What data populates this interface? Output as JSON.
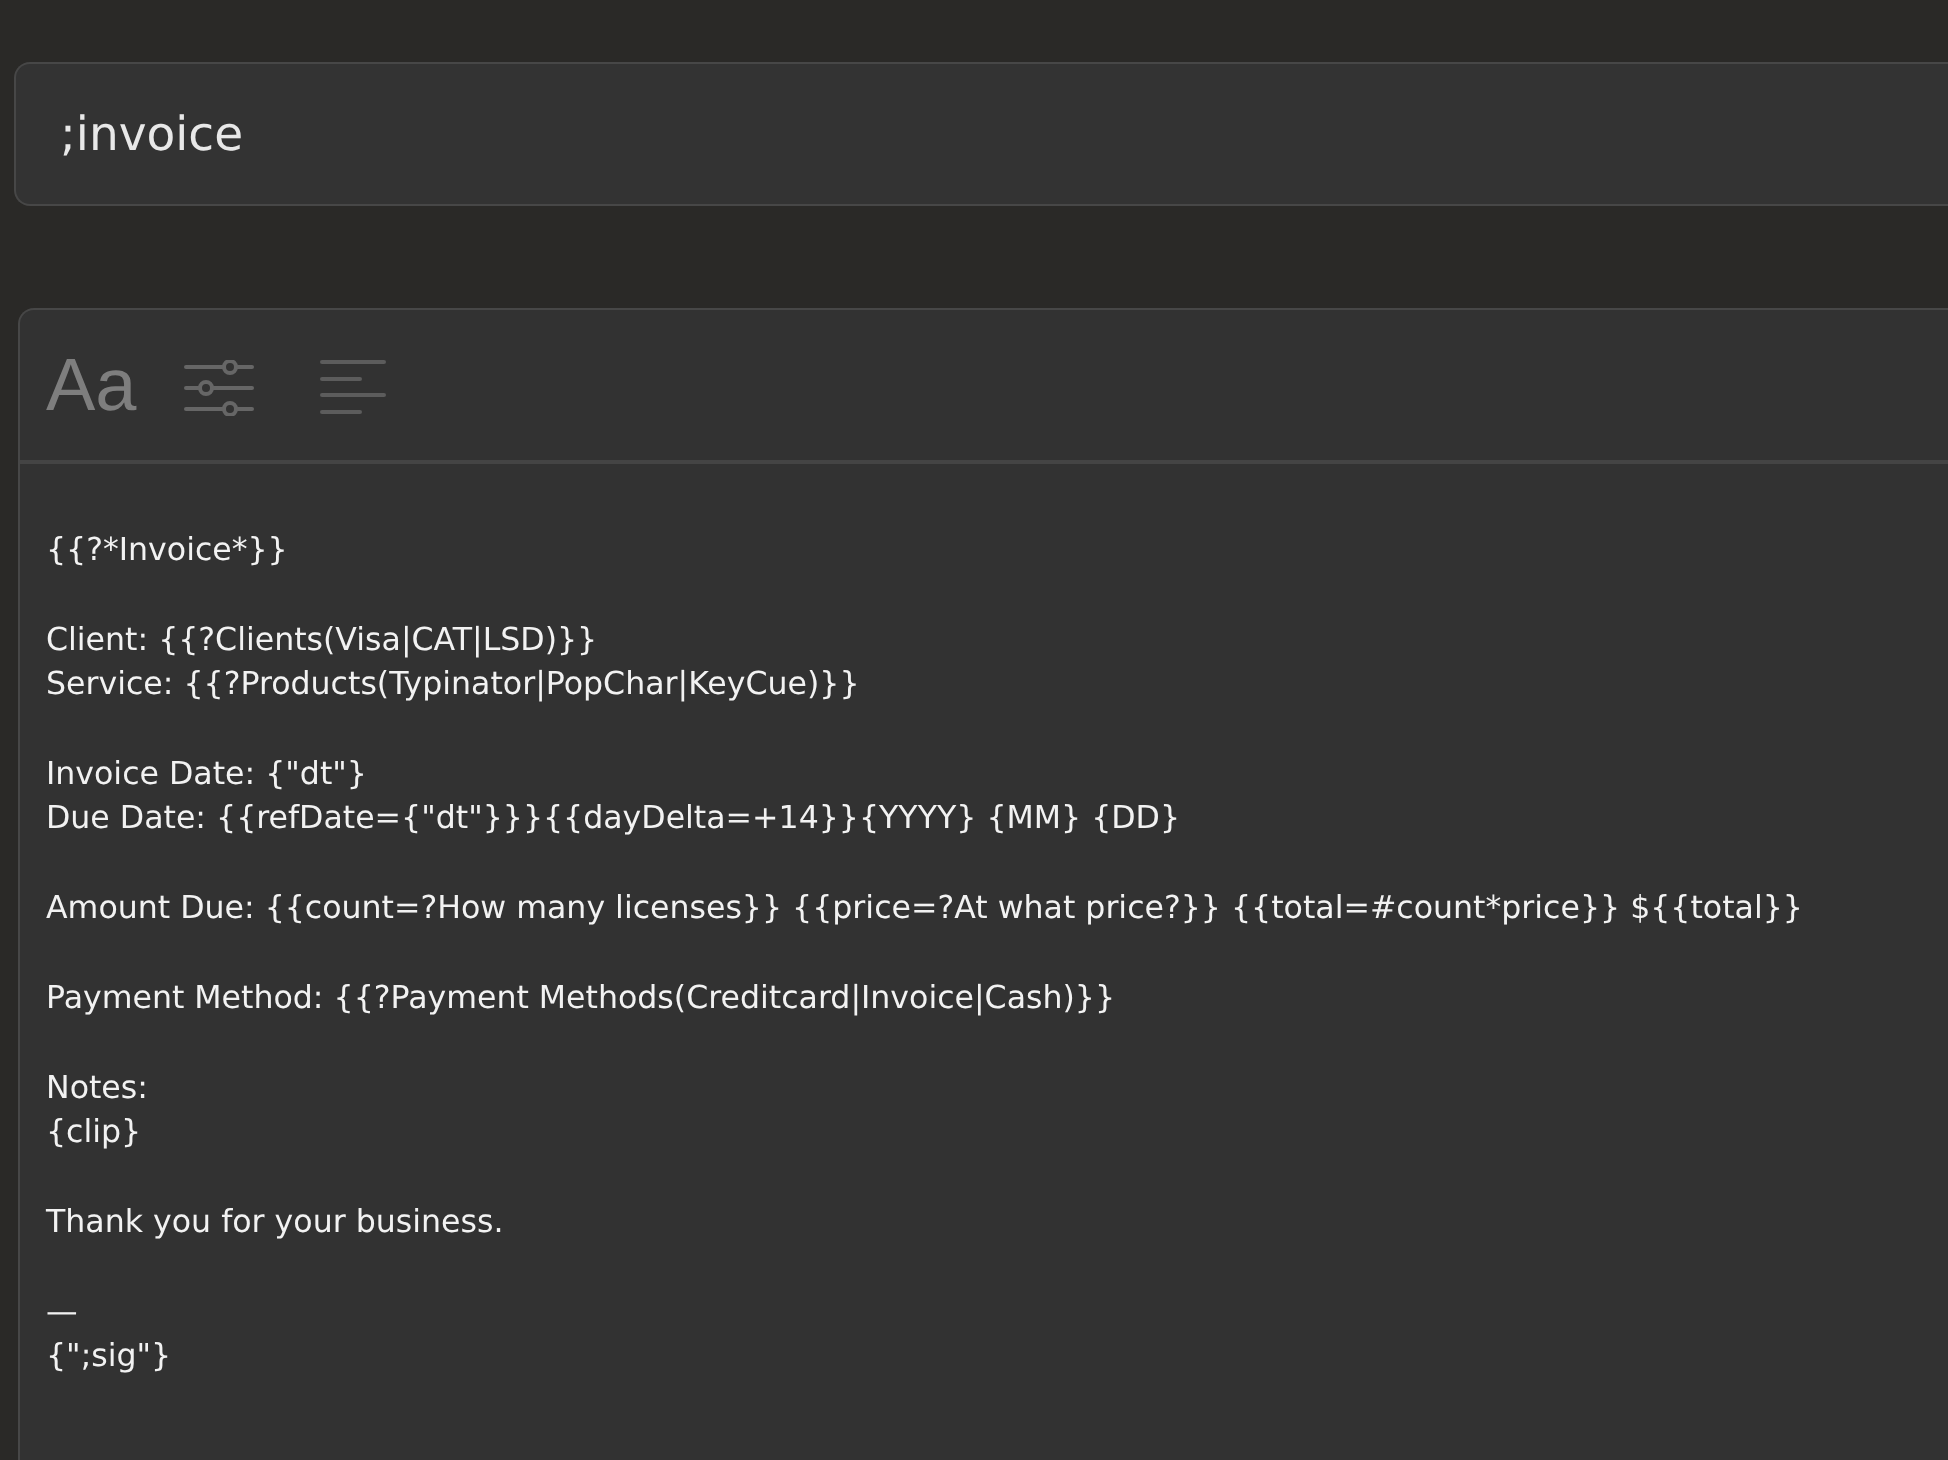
{
  "abbreviation": {
    "value": ";invoice"
  },
  "toolbar": {
    "font_button": "Aa"
  },
  "content": {
    "paragraphs": [
      [
        "{{?*Invoice*}}"
      ],
      [
        "Client: {{?Clients(Visa|CAT|LSD)}}",
        "Service: {{?Products(Typinator|PopChar|KeyCue)}}"
      ],
      [
        "Invoice Date: {\"dt\"}",
        "Due Date: {{refDate={\"dt\"}}}{{dayDelta=+14}}{YYYY} {MM} {DD}"
      ],
      [
        "Amount Due: {{count=?How many licenses}} {{price=?At what price?}} {{total=#count*price}} ${{total}}"
      ],
      [
        "Payment Method: {{?Payment Methods(Creditcard|Invoice|Cash)}}"
      ],
      [
        "Notes:",
        "{clip}"
      ],
      [
        "Thank you for your business."
      ],
      [
        "—",
        "{\";sig\"}"
      ]
    ]
  }
}
